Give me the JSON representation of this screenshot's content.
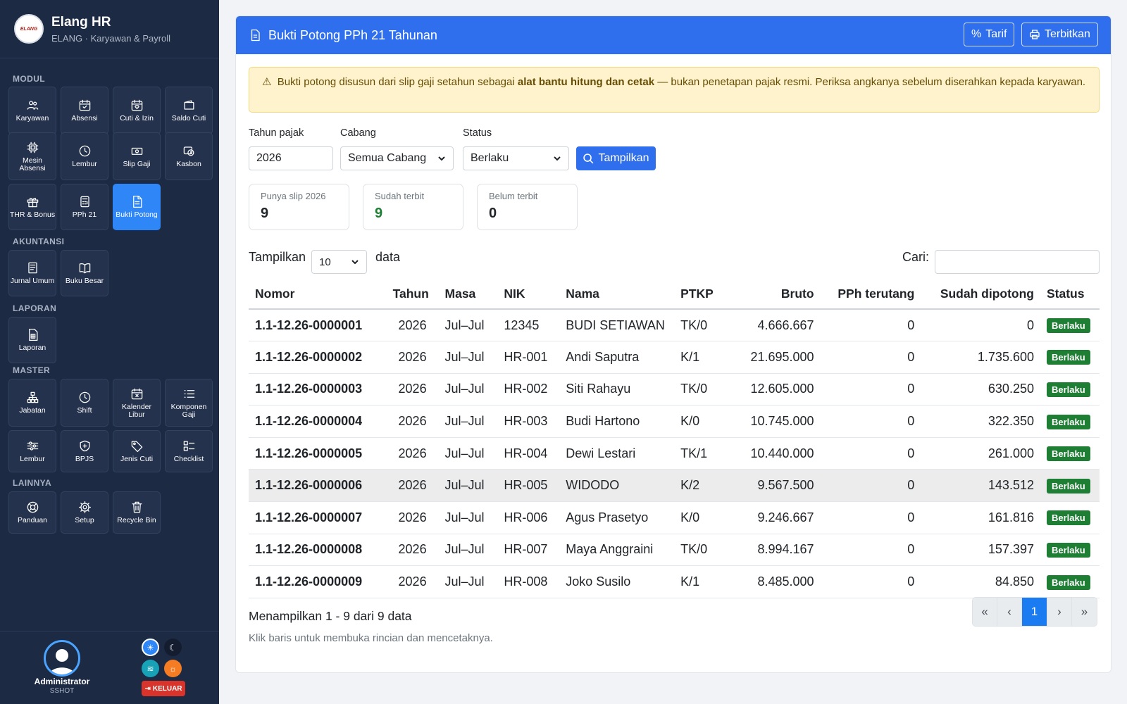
{
  "brand": {
    "title": "Elang HR",
    "subtitle": "ELANG · Karyawan & Payroll",
    "logo_text": "ELANG"
  },
  "sidebar": {
    "sections": [
      {
        "label": "MODUL",
        "items": [
          {
            "label": "Karyawan",
            "icon": "users-icon"
          },
          {
            "label": "Absensi",
            "icon": "calendar-check-icon"
          },
          {
            "label": "Cuti & Izin",
            "icon": "calendar-heart-icon"
          },
          {
            "label": "Saldo Cuti",
            "icon": "wallet-icon"
          },
          {
            "label": "Mesin Absensi",
            "icon": "chip-icon"
          },
          {
            "label": "Lembur",
            "icon": "clock-icon"
          },
          {
            "label": "Slip Gaji",
            "icon": "cash-icon"
          },
          {
            "label": "Kasbon",
            "icon": "coins-icon"
          },
          {
            "label": "THR & Bonus",
            "icon": "gift-icon"
          },
          {
            "label": "PPh 21",
            "icon": "calculator-icon"
          },
          {
            "label": "Bukti Potong",
            "icon": "file-text-icon",
            "active": true
          }
        ]
      },
      {
        "label": "AKUNTANSI",
        "items": [
          {
            "label": "Jurnal Umum",
            "icon": "journal-icon"
          },
          {
            "label": "Buku Besar",
            "icon": "book-icon"
          }
        ]
      },
      {
        "label": "LAPORAN",
        "items": [
          {
            "label": "Laporan",
            "icon": "report-icon"
          }
        ]
      },
      {
        "label": "MASTER",
        "items": [
          {
            "label": "Jabatan",
            "icon": "hierarchy-icon"
          },
          {
            "label": "Shift",
            "icon": "clock-icon"
          },
          {
            "label": "Kalender Libur",
            "icon": "calendar-x-icon"
          },
          {
            "label": "Komponen Gaji",
            "icon": "list-icon"
          },
          {
            "label": "Lembur",
            "icon": "sliders-icon"
          },
          {
            "label": "BPJS",
            "icon": "shield-plus-icon"
          },
          {
            "label": "Jenis Cuti",
            "icon": "tag-icon"
          },
          {
            "label": "Checklist",
            "icon": "checklist-icon"
          }
        ]
      },
      {
        "label": "LAINNYA",
        "items": [
          {
            "label": "Panduan",
            "icon": "lifebuoy-icon"
          },
          {
            "label": "Setup",
            "icon": "gear-icon"
          },
          {
            "label": "Recycle Bin",
            "icon": "trash-icon"
          }
        ]
      }
    ],
    "user": {
      "name": "Administrator",
      "role": "SSHOT"
    },
    "logout_label": "KELUAR"
  },
  "header": {
    "title": "Bukti Potong PPh 21 Tahunan",
    "tarif_label": "Tarif",
    "terbitkan_label": "Terbitkan"
  },
  "alert": {
    "before": "Bukti potong disusun dari slip gaji setahun sebagai ",
    "bold": "alat bantu hitung dan cetak",
    "after": " — bukan penetapan pajak resmi. Periksa angkanya sebelum diserahkan kepada karyawan."
  },
  "filters": {
    "tahun_label": "Tahun pajak",
    "tahun_value": "2026",
    "cabang_label": "Cabang",
    "cabang_value": "Semua Cabang",
    "status_label": "Status",
    "status_value": "Berlaku",
    "show_label": "Tampilkan"
  },
  "stats": [
    {
      "label": "Punya slip 2026",
      "value": "9",
      "color": "#212529"
    },
    {
      "label": "Sudah terbit",
      "value": "9",
      "color": "#1e7e34"
    },
    {
      "label": "Belum terbit",
      "value": "0",
      "color": "#212529"
    }
  ],
  "datatable": {
    "show_label": "Tampilkan",
    "page_size": "10",
    "data_label": "data",
    "search_label": "Cari:",
    "search_value": ""
  },
  "table": {
    "columns": [
      "Nomor",
      "Tahun",
      "Masa",
      "NIK",
      "Nama",
      "PTKP",
      "Bruto",
      "PPh terutang",
      "Sudah dipotong",
      "Status"
    ],
    "rows": [
      {
        "nomor": "1.1-12.26-0000001",
        "tahun": "2026",
        "masa": "Jul–Jul",
        "nik": "12345",
        "nama": "BUDI SETIAWAN",
        "ptkp": "TK/0",
        "bruto": "4.666.667",
        "terutang": "0",
        "dipotong": "0",
        "status": "Berlaku"
      },
      {
        "nomor": "1.1-12.26-0000002",
        "tahun": "2026",
        "masa": "Jul–Jul",
        "nik": "HR-001",
        "nama": "Andi Saputra",
        "ptkp": "K/1",
        "bruto": "21.695.000",
        "terutang": "0",
        "dipotong": "1.735.600",
        "status": "Berlaku"
      },
      {
        "nomor": "1.1-12.26-0000003",
        "tahun": "2026",
        "masa": "Jul–Jul",
        "nik": "HR-002",
        "nama": "Siti Rahayu",
        "ptkp": "TK/0",
        "bruto": "12.605.000",
        "terutang": "0",
        "dipotong": "630.250",
        "status": "Berlaku"
      },
      {
        "nomor": "1.1-12.26-0000004",
        "tahun": "2026",
        "masa": "Jul–Jul",
        "nik": "HR-003",
        "nama": "Budi Hartono",
        "ptkp": "K/0",
        "bruto": "10.745.000",
        "terutang": "0",
        "dipotong": "322.350",
        "status": "Berlaku"
      },
      {
        "nomor": "1.1-12.26-0000005",
        "tahun": "2026",
        "masa": "Jul–Jul",
        "nik": "HR-004",
        "nama": "Dewi Lestari",
        "ptkp": "TK/1",
        "bruto": "10.440.000",
        "terutang": "0",
        "dipotong": "261.000",
        "status": "Berlaku"
      },
      {
        "nomor": "1.1-12.26-0000006",
        "tahun": "2026",
        "masa": "Jul–Jul",
        "nik": "HR-005",
        "nama": "WIDODO",
        "ptkp": "K/2",
        "bruto": "9.567.500",
        "terutang": "0",
        "dipotong": "143.512",
        "status": "Berlaku",
        "highlight": true
      },
      {
        "nomor": "1.1-12.26-0000007",
        "tahun": "2026",
        "masa": "Jul–Jul",
        "nik": "HR-006",
        "nama": "Agus Prasetyo",
        "ptkp": "K/0",
        "bruto": "9.246.667",
        "terutang": "0",
        "dipotong": "161.816",
        "status": "Berlaku"
      },
      {
        "nomor": "1.1-12.26-0000008",
        "tahun": "2026",
        "masa": "Jul–Jul",
        "nik": "HR-007",
        "nama": "Maya Anggraini",
        "ptkp": "TK/0",
        "bruto": "8.994.167",
        "terutang": "0",
        "dipotong": "157.397",
        "status": "Berlaku"
      },
      {
        "nomor": "1.1-12.26-0000009",
        "tahun": "2026",
        "masa": "Jul–Jul",
        "nik": "HR-008",
        "nama": "Joko Susilo",
        "ptkp": "K/1",
        "bruto": "8.485.000",
        "terutang": "0",
        "dipotong": "84.850",
        "status": "Berlaku"
      }
    ]
  },
  "footer": {
    "info": "Menampilkan 1 - 9 dari 9 data",
    "hint": "Klik baris untuk membuka rincian dan mencetaknya."
  },
  "pagination": {
    "first": "«",
    "prev": "‹",
    "current": "1",
    "next": "›",
    "last": "»"
  },
  "colors": {
    "sidebar": "#1c2a44",
    "primary": "#2f6fed",
    "active_module": "#2f86f6",
    "badge_green": "#1e7e34",
    "alert_bg": "#fff3cd"
  }
}
